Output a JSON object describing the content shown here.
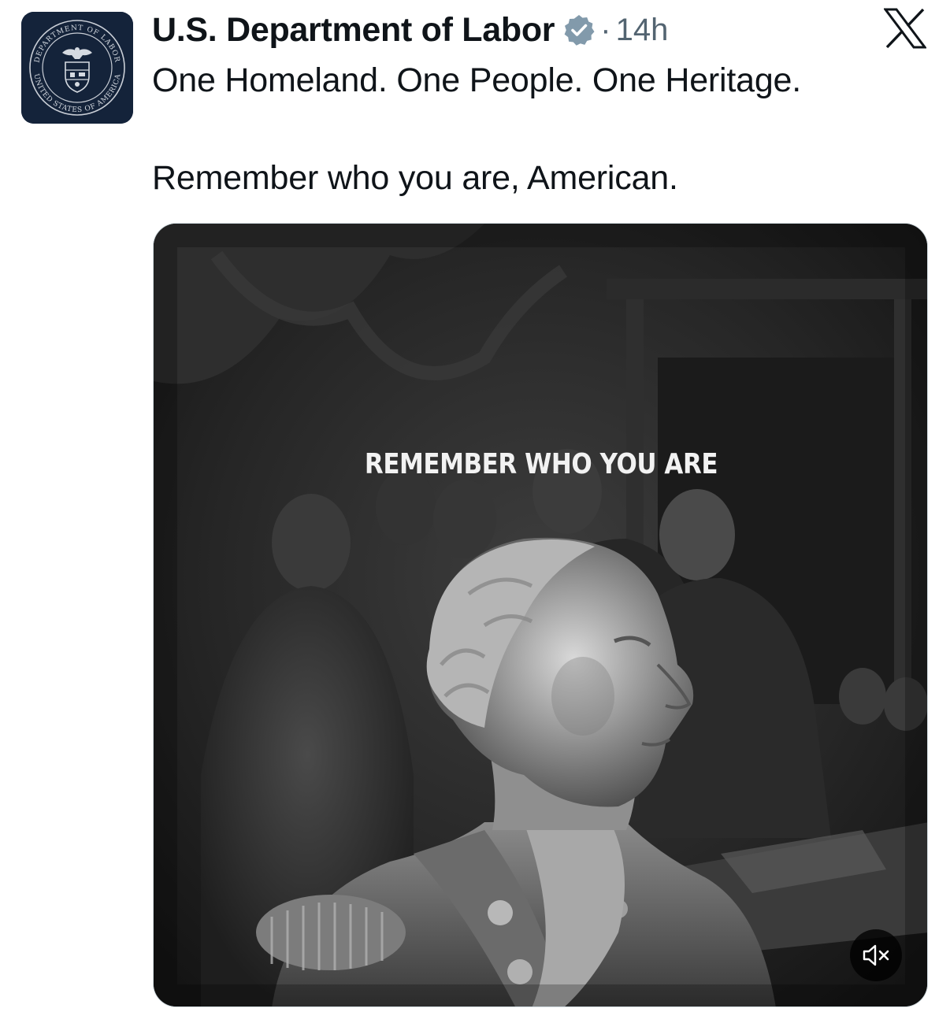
{
  "post": {
    "author": {
      "display_name": "U.S. Department of Labor",
      "verified": true,
      "avatar_seal_top_text": "DEPARTMENT OF LABOR",
      "avatar_seal_bottom_text": "UNITED STATES OF AMERICA"
    },
    "separator": "·",
    "timestamp": "14h",
    "platform_icon": "x-logo-icon",
    "text_lines": [
      "One Homeland. One People. One Heritage.",
      "Remember who you are, American."
    ],
    "media": {
      "type": "video",
      "overlay_text": "REMEMBER WHO YOU ARE",
      "muted": true,
      "mute_icon": "speaker-muted-icon"
    }
  },
  "colors": {
    "text_primary": "#0f1419",
    "text_secondary": "#536471",
    "verified_badge": "#829aab",
    "avatar_bg": "#14233a"
  }
}
